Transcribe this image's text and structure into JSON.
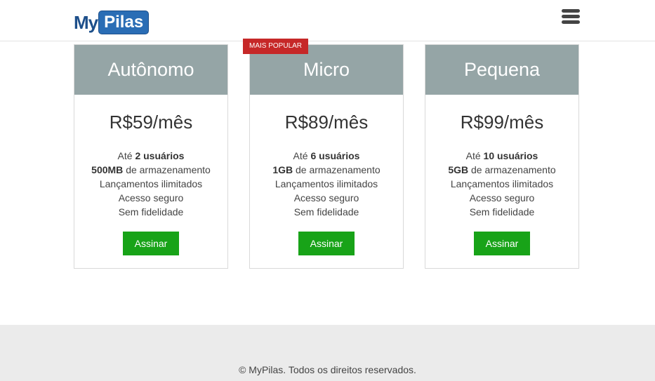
{
  "header": {
    "logo_my": "My",
    "logo_pilas": "Pilas"
  },
  "badge": "MAIS POPULAR",
  "plans": [
    {
      "name": "Autônomo",
      "price": "R$59/mês",
      "users_prefix": "Até",
      "users": "2 usuários",
      "storage": "500MB",
      "storage_suffix": "de armazenamento",
      "feature1": "Lançamentos ilimitados",
      "feature2": "Acesso seguro",
      "feature3": "Sem fidelidade",
      "button": "Assinar"
    },
    {
      "name": "Micro",
      "price": "R$89/mês",
      "users_prefix": "Até",
      "users": "6 usuários",
      "storage": "1GB",
      "storage_suffix": "de armazenamento",
      "feature1": "Lançamentos ilimitados",
      "feature2": "Acesso seguro",
      "feature3": "Sem fidelidade",
      "button": "Assinar"
    },
    {
      "name": "Pequena",
      "price": "R$99/mês",
      "users_prefix": "Até",
      "users": "10 usuários",
      "storage": "5GB",
      "storage_suffix": "de armazenamento",
      "feature1": "Lançamentos ilimitados",
      "feature2": "Acesso seguro",
      "feature3": "Sem fidelidade",
      "button": "Assinar"
    }
  ],
  "footer": {
    "copyright": "© MyPilas. Todos os direitos reservados."
  },
  "colors": {
    "card_header": "#95a5a6",
    "button": "#18a318",
    "badge": "#c62828",
    "logo": "#2a6db5"
  },
  "icons": {
    "menu": "hamburger-menu-icon"
  }
}
